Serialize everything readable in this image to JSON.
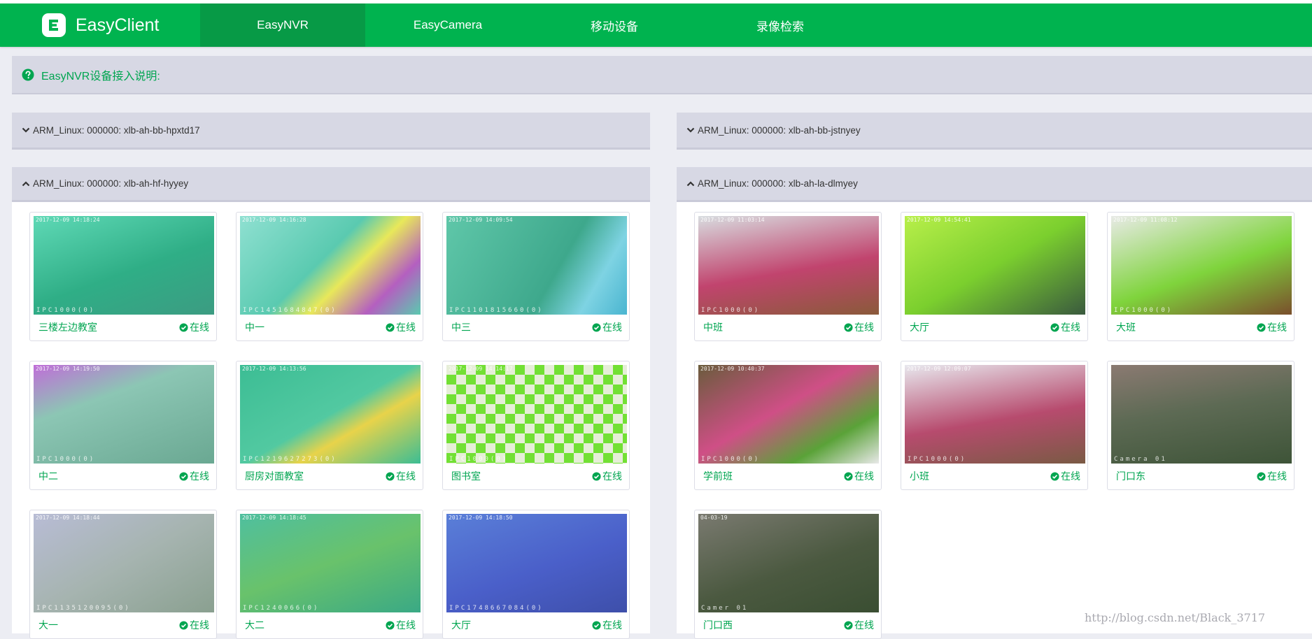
{
  "app": {
    "brand": "EasyClient",
    "nav": [
      "EasyNVR",
      "EasyCamera",
      "移动设备",
      "录像检索"
    ],
    "active_index": 0,
    "accent": "#00b34f",
    "accent_dark": "#079a46",
    "text_green": "#00a550"
  },
  "info": {
    "text": "EasyNVR设备接入说明:",
    "icon": "question-circle-icon"
  },
  "panels": {
    "left_collapsed": {
      "title": "ARM_Linux: 000000: xlb-ah-bb-hpxtd17",
      "icon": "chevron-down-icon"
    },
    "right_collapsed": {
      "title": "ARM_Linux: 000000: xlb-ah-bb-jstnyey",
      "icon": "chevron-down-icon"
    },
    "left_expanded": {
      "title": "ARM_Linux: 000000: xlb-ah-hf-hyyey",
      "icon": "chevron-up-icon",
      "cameras": [
        {
          "name": "三楼左边教室",
          "status": "在线",
          "osd": "2017-12-09 14:18:24",
          "osd2": "IPC1000(0)"
        },
        {
          "name": "中一",
          "status": "在线",
          "osd": "2017-12-09 14:16:28",
          "osd2": "IPC1451684847(0)"
        },
        {
          "name": "中三",
          "status": "在线",
          "osd": "2017-12-09 14:09:54",
          "osd2": "IPC1101815660(0)"
        },
        {
          "name": "中二",
          "status": "在线",
          "osd": "2017-12-09 14:19:50",
          "osd2": "IPC1000(0)"
        },
        {
          "name": "厨房对面教室",
          "status": "在线",
          "osd": "2017-12-09 14:13:56",
          "osd2": "IPC1219627273(0)"
        },
        {
          "name": "图书室",
          "status": "在线",
          "osd": "2017-12-09 14:14:17",
          "osd2": "IPC1000(0)"
        },
        {
          "name": "大一",
          "status": "在线",
          "osd": "2017-12-09 14:18:44",
          "osd2": "IPC1135120095(0)"
        },
        {
          "name": "大二",
          "status": "在线",
          "osd": "2017-12-09 14:18:45",
          "osd2": "IPC1240066(0)"
        },
        {
          "name": "大厅",
          "status": "在线",
          "osd": "2017-12-09 14:18:50",
          "osd2": "IPC1748667084(0)"
        }
      ]
    },
    "right_expanded": {
      "title": "ARM_Linux: 000000: xlb-ah-la-dlmyey",
      "icon": "chevron-up-icon",
      "cameras": [
        {
          "name": "中班",
          "status": "在线",
          "osd": "2017-12-09 11:03:14",
          "osd2": "IPC1000(0)"
        },
        {
          "name": "大厅",
          "status": "在线",
          "osd": "2017-12-09 14:54:41",
          "osd2": ""
        },
        {
          "name": "大班",
          "status": "在线",
          "osd": "2017-12-09 11:08:12",
          "osd2": "IPC1000(0)"
        },
        {
          "name": "学前班",
          "status": "在线",
          "osd": "2017-12-09 10:40:37",
          "osd2": "IPC1000(0)"
        },
        {
          "name": "小班",
          "status": "在线",
          "osd": "2017-12-09 12:09:07",
          "osd2": "IPC1000(0)"
        },
        {
          "name": "门口东",
          "status": "在线",
          "osd": "",
          "osd2": "Camera 01"
        },
        {
          "name": "门口西",
          "status": "在线",
          "osd": "04-03-19",
          "osd2": "Camer 01"
        }
      ]
    }
  },
  "watermark": "http://blog.csdn.net/Black_3717"
}
